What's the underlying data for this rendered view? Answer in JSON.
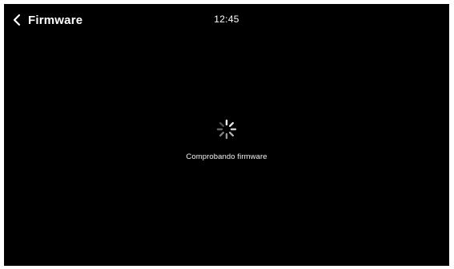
{
  "header": {
    "back_label": "Firmware",
    "time": "12:45"
  },
  "main": {
    "status_text": "Comprobando firmware"
  },
  "icons": {
    "back": "chevron-left-icon",
    "loading": "loading-spinner-icon"
  },
  "colors": {
    "background": "#000000",
    "text": "#ffffff"
  }
}
